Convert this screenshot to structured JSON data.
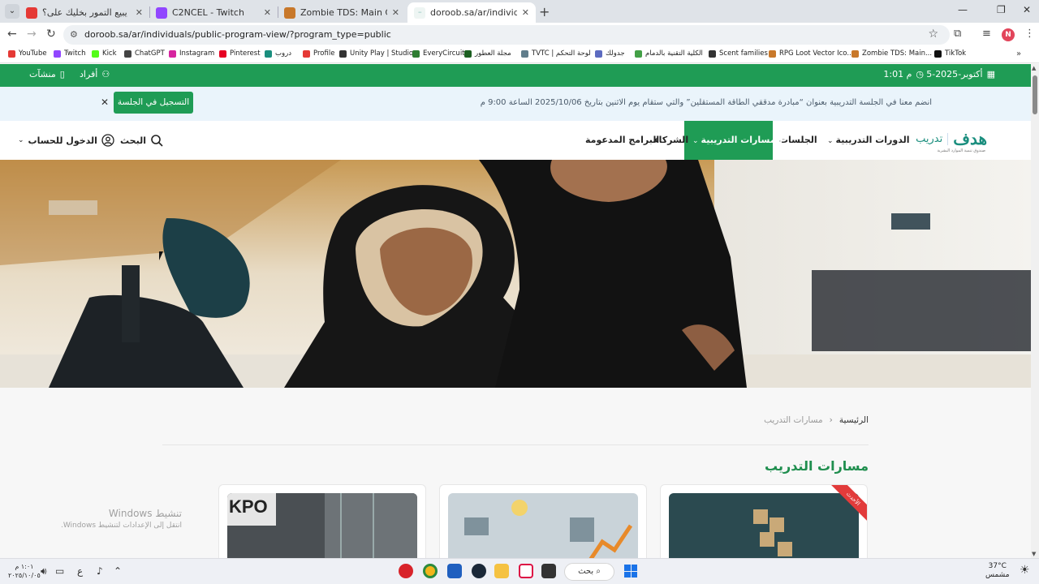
{
  "browser": {
    "tabs": [
      {
        "title": "هل يبيع التمور بخليك على؟ 🌴 ✌ 🎥",
        "active": false,
        "color": "#e53935"
      },
      {
        "title": "C2NCEL - Twitch",
        "active": false,
        "color": "#9146ff"
      },
      {
        "title": "Zombie TDS: Main Characters",
        "active": false,
        "color": "#c8782a"
      },
      {
        "title": "doroob.sa/ar/individuals/public",
        "active": true,
        "color": "#1a8e7e"
      }
    ],
    "url": "doroob.sa/ar/individuals/public-program-view/?program_type=public",
    "profile_initial": "N",
    "bookmarks": [
      {
        "label": "YouTube",
        "color": "#e53935"
      },
      {
        "label": "Twitch",
        "color": "#9146ff"
      },
      {
        "label": "Kick",
        "color": "#53fc18"
      },
      {
        "label": "ChatGPT",
        "color": "#444444"
      },
      {
        "label": "Instagram",
        "color": "#d6249f"
      },
      {
        "label": "Pinterest",
        "color": "#e60023"
      },
      {
        "label": "دروب",
        "color": "#1a8e7e"
      },
      {
        "label": "Profile",
        "color": "#e53935"
      },
      {
        "label": "Unity Play | Studio",
        "color": "#333333"
      },
      {
        "label": "EveryCircuit",
        "color": "#2e7d32"
      },
      {
        "label": "مجلة العطور",
        "color": "#1b5e20"
      },
      {
        "label": "TVTC | لوحة التحكم",
        "color": "#607d8b"
      },
      {
        "label": "جدولك",
        "color": "#5c6bc0"
      },
      {
        "label": "الكلية التقنية بالدمام",
        "color": "#43a047"
      },
      {
        "label": "Scent families",
        "color": "#333333"
      },
      {
        "label": "RPG Loot Vector Ico...",
        "color": "#c8782a"
      },
      {
        "label": "Zombie TDS: Main...",
        "color": "#c8782a"
      },
      {
        "label": "TikTok",
        "color": "#111111"
      }
    ]
  },
  "site": {
    "topbar": {
      "date": "5-أكتوبر-2025",
      "time": "1:01 م",
      "individuals": "أفراد",
      "establishments": "منشآت"
    },
    "announcement": {
      "text": "انضم معنا في الجلسة التدريبية بعنوان “مبادرة مدققي الطاقة المستقلين” والتي ستقام يوم الاثنين بتاريخ 2025/10/06 الساعة 9:00 م",
      "button": "التسجيل في الجلسة"
    },
    "logo": {
      "mark": "هدف",
      "sub": "تدريب",
      "tag": "صندوق تنمية الموارد البشرية"
    },
    "nav": {
      "courses": "الدورات التدريبية",
      "sessions": "الجلسات",
      "tracks": "المسارات التدريبية",
      "partners": "الشركاء",
      "supported": "البرامج المدعومة",
      "search": "البحث",
      "login": "الدخول للحساب"
    },
    "breadcrumb": {
      "home": "الرئيسية",
      "current": "مسارات التدريب"
    },
    "section_title": "مسارات التدريب",
    "card_badge": "الأحدث",
    "card1_text": "KPO"
  },
  "windows_watermark": {
    "line1": "تنشيط Windows",
    "line2": "انتقل إلى الإعدادات لتنشيط Windows."
  },
  "taskbar": {
    "time": "١:٠١ م",
    "date": "٢٠٢٥/١٠/٠٥",
    "lang": "ع",
    "search": "بحث",
    "temp": "37°C",
    "weather": "مشمس"
  }
}
